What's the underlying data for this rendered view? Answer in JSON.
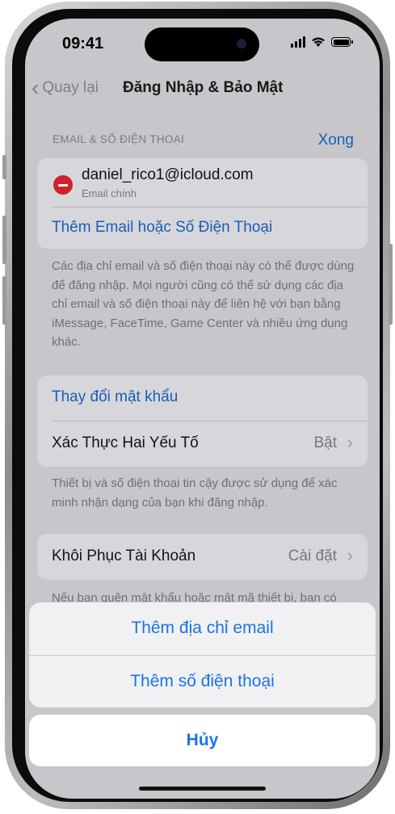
{
  "status_bar": {
    "time": "09:41"
  },
  "nav": {
    "back_label": "Quay lại",
    "title": "Đăng Nhập & Bảo Mật"
  },
  "email_section": {
    "header": "EMAIL & SỐ ĐIỆN THOẠI",
    "done_label": "Xong",
    "email": "daniel_rico1@icloud.com",
    "email_caption": "Email chính",
    "add_label": "Thêm Email hoặc Số Điện Thoại",
    "footer": "Các địa chỉ email và số điện thoại này có thể được dùng để đăng nhập. Mọi người cũng có thể sử dụng các địa chỉ email và số điện thoại này để liên hệ với bạn bằng iMessage, FaceTime, Game Center và nhiều ứng dụng khác."
  },
  "security_section": {
    "change_password": "Thay đổi mật khẩu",
    "two_factor_label": "Xác Thực Hai Yếu Tố",
    "two_factor_value": "Bật",
    "footer": "Thiết bị và số điện thoại tin cậy được sử dụng để xác minh nhận dạng của bạn khi đăng nhập."
  },
  "recovery_section": {
    "label": "Khôi Phục Tài Khoản",
    "value": "Cài đặt",
    "footer_partial": "Nếu bạn quên mật khẩu hoặc mật mã thiết bị, bạn có"
  },
  "action_sheet": {
    "add_email": "Thêm địa chỉ email",
    "add_phone": "Thêm  số điện thoại",
    "cancel": "Hủy"
  },
  "colors": {
    "link": "#1a5fb4",
    "action": "#1a74e8",
    "destructive": "#d0202b"
  }
}
